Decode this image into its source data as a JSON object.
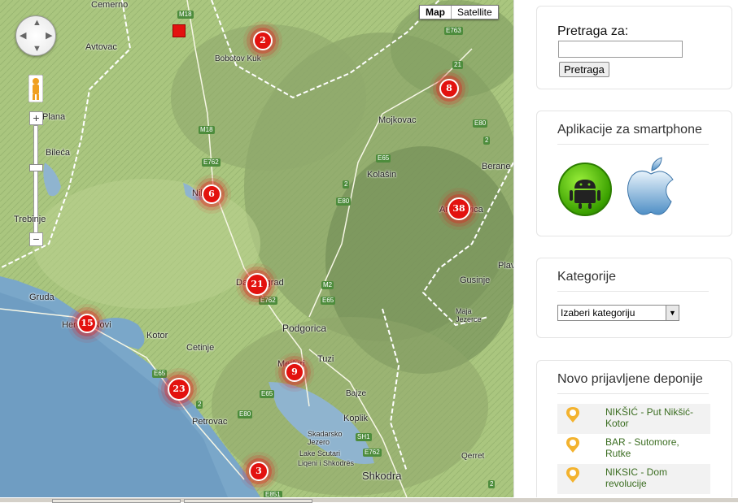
{
  "map": {
    "type_controls": {
      "map": "Map",
      "satellite": "Satellite"
    },
    "zoom": {
      "plus": "+",
      "minus": "−"
    },
    "places": [
      {
        "name": "Cemerno"
      },
      {
        "name": "Avtovac"
      },
      {
        "name": "Bobotov Kuk"
      },
      {
        "name": "Plana"
      },
      {
        "name": "Bileća"
      },
      {
        "name": "Trebinje"
      },
      {
        "name": "Mojkovac"
      },
      {
        "name": "Kolašin"
      },
      {
        "name": "Berane"
      },
      {
        "name": "Gusinje"
      },
      {
        "name": "Plav"
      },
      {
        "name": "Gruda"
      },
      {
        "name": "Kotor"
      },
      {
        "name": "Cetinje"
      },
      {
        "name": "Podgorica"
      },
      {
        "name": "Tuzi"
      },
      {
        "name": "Bajze"
      },
      {
        "name": "Petrovac"
      },
      {
        "name": "Koplik"
      },
      {
        "name": "Skadarsko Jezero"
      },
      {
        "name": "Lake Scutari"
      },
      {
        "name": "Liqeni i Shkodrës"
      },
      {
        "name": "Shkodra"
      },
      {
        "name": "Qerret"
      },
      {
        "name": "Maja Jezerce"
      }
    ],
    "roads": [
      "M18",
      "E763",
      "21",
      "E80",
      "2",
      "M18",
      "E762",
      "E65",
      "2",
      "E80",
      "M2",
      "E65",
      "E762",
      "E65",
      "E65",
      "E80",
      "SH1",
      "E762",
      "E851",
      "2",
      "2"
    ],
    "clusters": [
      {
        "count": "2"
      },
      {
        "count": "8"
      },
      {
        "count": "6"
      },
      {
        "count": "38"
      },
      {
        "count": "21"
      },
      {
        "count": "15"
      },
      {
        "count": "9"
      },
      {
        "count": "23"
      },
      {
        "count": "3"
      }
    ],
    "partial_labels": [
      "Danilovgrad",
      "Herceg Novi",
      "Andrijevica",
      "Nikšić",
      "Meduri"
    ]
  },
  "sidebar": {
    "search": {
      "label": "Pretraga za:",
      "value": "",
      "button": "Pretraga"
    },
    "apps": {
      "title": "Aplikacije za smartphone"
    },
    "categories": {
      "title": "Kategorije",
      "selected": "Izaberi kategoriju"
    },
    "new_dumps": {
      "title": "Novo prijavljene deponije",
      "items": [
        {
          "line1": "NIKŠIĆ - Put Nikšić-",
          "line2": "Kotor"
        },
        {
          "line1": "BAR - Sutomore,",
          "line2": "Rutke"
        },
        {
          "line1": "NIKSIC - Dom",
          "line2": "revolucije"
        }
      ]
    }
  },
  "colors": {
    "cluster": "#e3120f",
    "link": "#3b6d21",
    "road": "#4d8c3c",
    "sea": "#7aa7c9"
  }
}
